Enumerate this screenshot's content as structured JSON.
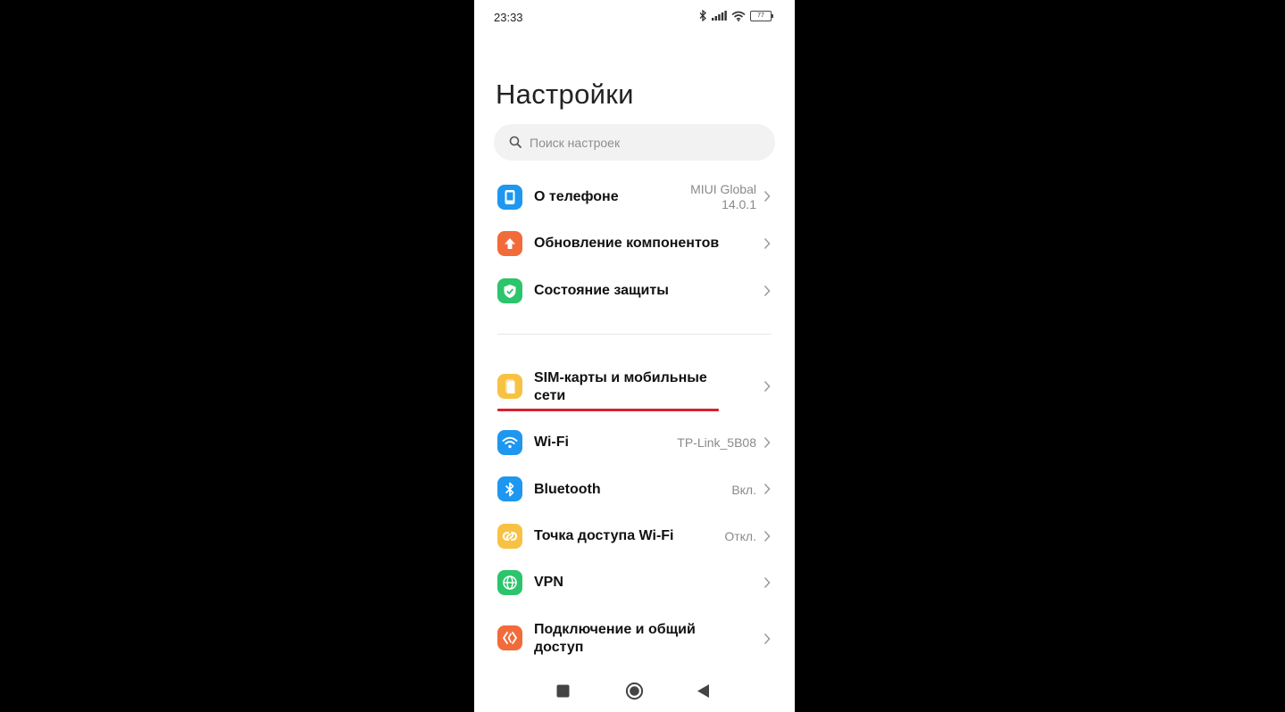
{
  "status_bar": {
    "time": "23:33",
    "battery": "77"
  },
  "title": "Настройки",
  "search": {
    "placeholder": "Поиск настроек"
  },
  "items": [
    {
      "label": "О телефоне",
      "value_line1": "MIUI Global",
      "value_line2": "14.0.1",
      "icon": "phone-icon",
      "color": "#1e97f0"
    },
    {
      "label": "Обновление компонентов",
      "icon": "update-arrow-icon",
      "color": "#f26b3a"
    },
    {
      "label": "Состояние защиты",
      "icon": "shield-check-icon",
      "color": "#2cc46c"
    },
    {
      "label_line1": "SIM-карты и мобильные",
      "label_line2": "сети",
      "icon": "sim-card-icon",
      "color": "#f7c244"
    },
    {
      "label": "Wi-Fi",
      "value": "TP-Link_5B08",
      "icon": "wifi-icon",
      "color": "#1e97f0"
    },
    {
      "label": "Bluetooth",
      "value": "Вкл.",
      "icon": "bluetooth-icon",
      "color": "#1e97f0"
    },
    {
      "label": "Точка доступа Wi-Fi",
      "value": "Откл.",
      "icon": "hotspot-icon",
      "color": "#f7c244"
    },
    {
      "label": "VPN",
      "icon": "globe-icon",
      "color": "#2cc46c"
    },
    {
      "label_line1": "Подключение и общий",
      "label_line2": "доступ",
      "icon": "connection-sharing-icon",
      "color": "#f26b3a"
    }
  ],
  "accent": {
    "underline": "#d7232e"
  }
}
